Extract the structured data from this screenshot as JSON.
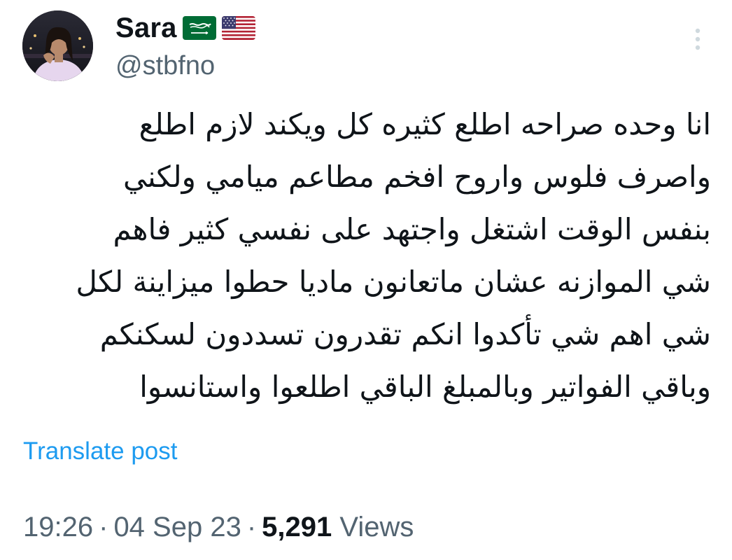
{
  "author": {
    "display_name": "Sara",
    "handle": "@stbfno",
    "flags": [
      "saudi-arabia-flag-icon",
      "united-states-flag-icon"
    ]
  },
  "tweet": {
    "text_lines": [
      "انا وحده صراحه اطلع كثيره كل ويكند لازم اطلع",
      "واصرف فلوس واروح افخم مطاعم ميامي ولكني",
      "بنفس الوقت اشتغل واجتهد على نفسي كثير فاهم",
      "شي الموازنه عشان ماتعانون ماديا حطوا ميزاينة لكل",
      "شي اهم شي تأكدوا انكم تقدرون تسددون لسكنكم",
      "وباقي الفواتير وبالمبلغ الباقي اطلعوا واستانسوا"
    ],
    "translate_label": "Translate post"
  },
  "meta": {
    "time": "19:26",
    "separator": "·",
    "date": "04 Sep 23",
    "views_count": "5,291",
    "views_label": "Views"
  },
  "colors": {
    "text_primary": "#0f1419",
    "text_secondary": "#536471",
    "link": "#1d9bf0",
    "more_icon": "#cfd9de"
  },
  "icons": {
    "more": "more-vertical-icon"
  }
}
